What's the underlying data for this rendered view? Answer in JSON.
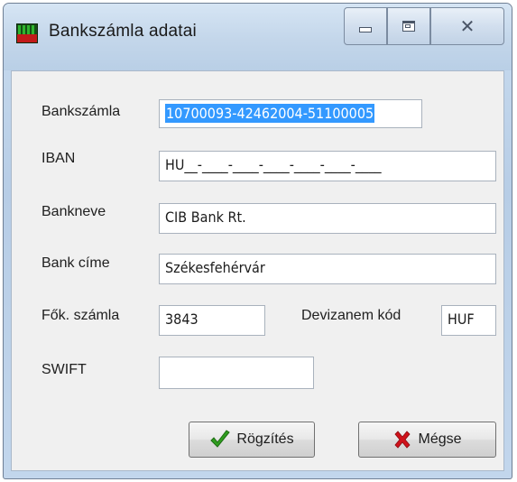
{
  "window": {
    "title": "Bankszámla adatai",
    "icon": "app-icon"
  },
  "form": {
    "bankszamla": {
      "label": "Bankszámla",
      "value": "10700093-42462004-51100005"
    },
    "iban": {
      "label": "IBAN",
      "value": "HU__-____-____-____-____-____-____"
    },
    "bankneve": {
      "label": "Bankneve",
      "value": "CIB Bank Rt."
    },
    "bank_cime": {
      "label": "Bank címe",
      "value": "Székesfehérvár"
    },
    "fok_szamla": {
      "label": "Fők. számla",
      "value": "3843"
    },
    "devizanem": {
      "label": "Devizanem kód",
      "value": "HUF"
    },
    "swift": {
      "label": "SWIFT",
      "value": ""
    }
  },
  "buttons": {
    "ok_label": "Rögzítés",
    "cancel_label": "Mégse"
  },
  "colors": {
    "selection": "#3399ff",
    "ok_icon": "#2f9e1f",
    "cancel_icon": "#d0121b"
  }
}
